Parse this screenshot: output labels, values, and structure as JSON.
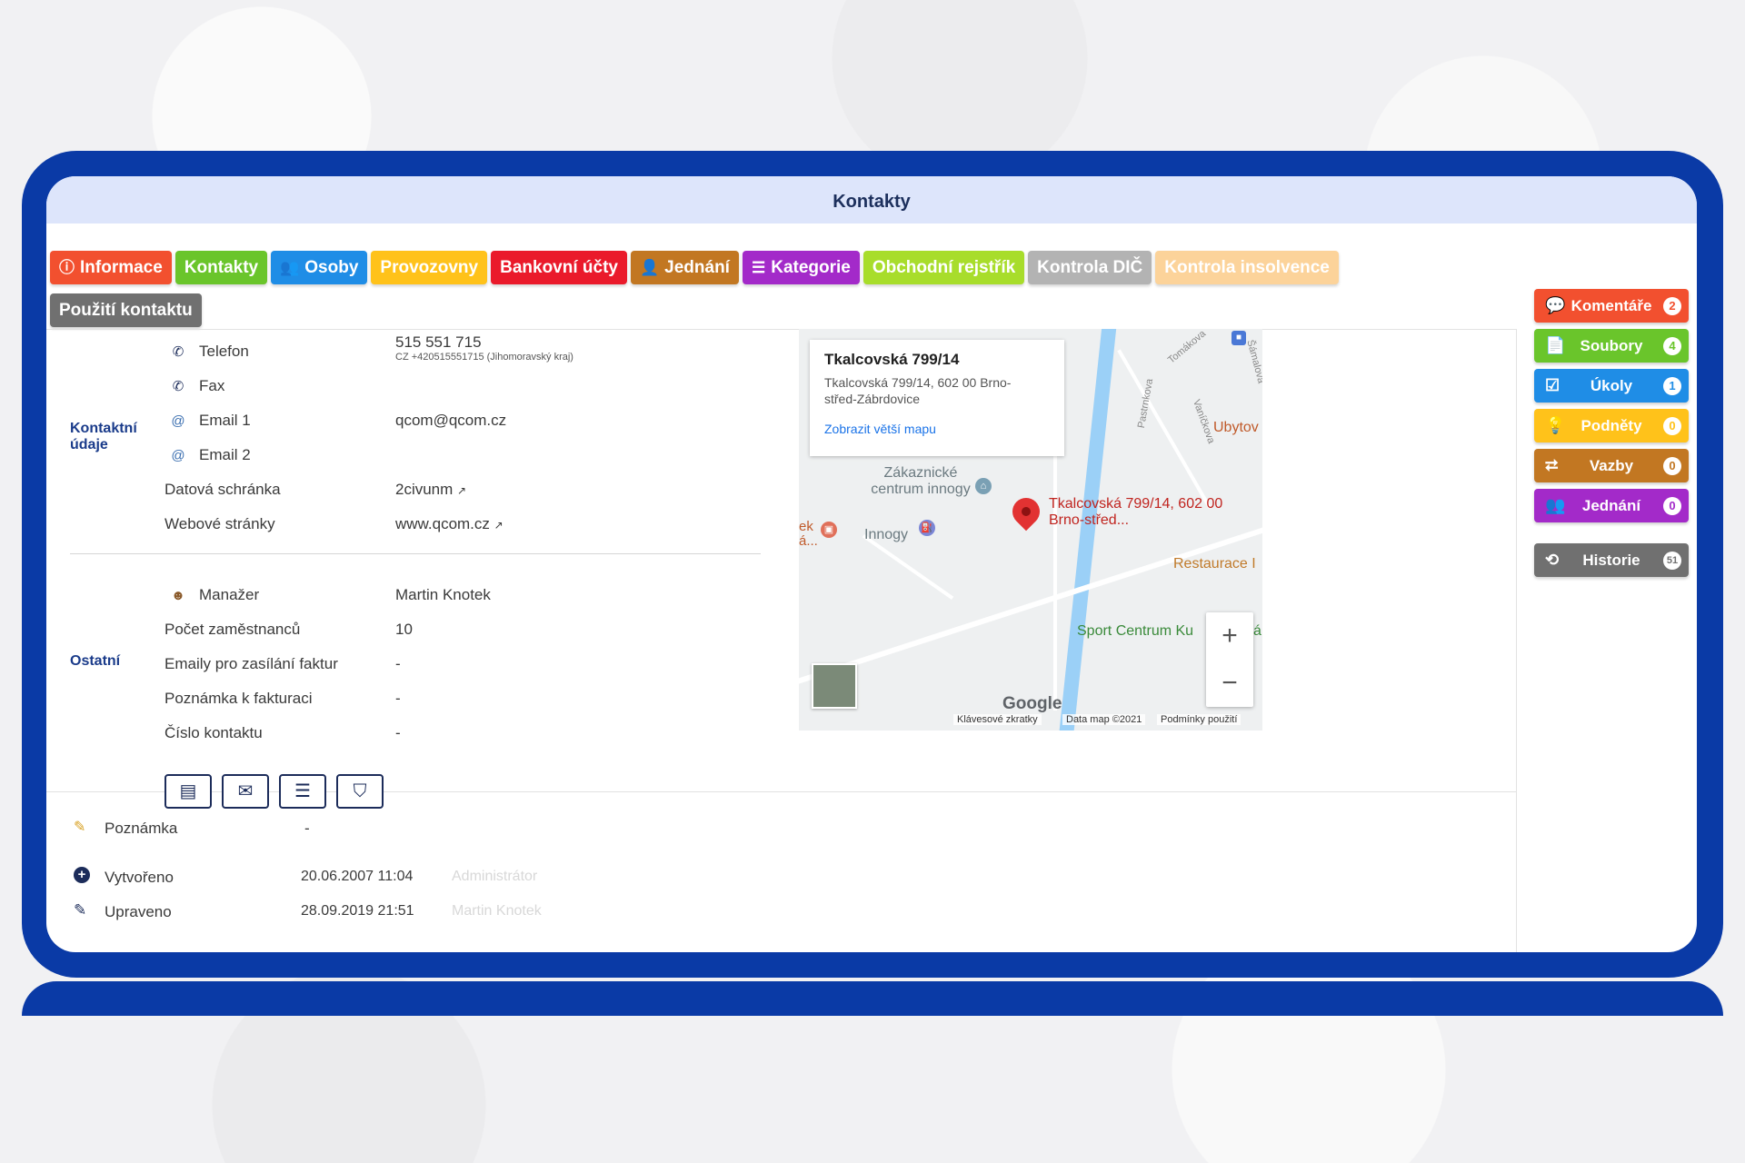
{
  "window_title": "Kontakty",
  "tabs": [
    {
      "label": "Informace",
      "icon": "ⓘ",
      "color": "#f2502f"
    },
    {
      "label": "Kontakty",
      "icon": "",
      "color": "#6ac52b"
    },
    {
      "label": "Osoby",
      "icon": "👥",
      "color": "#1f8de6"
    },
    {
      "label": "Provozovny",
      "icon": "",
      "color": "#ffc21a"
    },
    {
      "label": "Bankovní účty",
      "icon": "",
      "color": "#ea1a2b"
    },
    {
      "label": "Jednání",
      "icon": "👤",
      "color": "#c27722"
    },
    {
      "label": "Kategorie",
      "icon": "☰",
      "color": "#a32ac9"
    },
    {
      "label": "Obchodní rejstřík",
      "icon": "",
      "color": "#a8dd2b"
    },
    {
      "label": "Kontrola DIČ",
      "icon": "",
      "color": "#b3b3b3"
    },
    {
      "label": "Kontrola insolvence",
      "icon": "",
      "color": "#fcd39a"
    },
    {
      "label": "Použití kontaktu",
      "icon": "",
      "color": "#707070"
    }
  ],
  "contact": {
    "section_label": "Kontaktní údaje",
    "phone_label": "Telefon",
    "phone_value": "515 551 715",
    "phone_sub": "CZ +420515551715 (Jihomoravský kraj)",
    "fax_label": "Fax",
    "email1_label": "Email 1",
    "email1_value": "qcom@qcom.cz",
    "email2_label": "Email 2",
    "databox_label": "Datová schránka",
    "databox_value": "2civunm",
    "web_label": "Webové stránky",
    "web_value": "www.qcom.cz"
  },
  "other": {
    "section_label": "Ostatní",
    "manager_label": "Manažer",
    "manager_value": "Martin Knotek",
    "employees_label": "Počet zaměstnanců",
    "employees_value": "10",
    "invoice_emails_label": "Emaily pro zasílání faktur",
    "invoice_emails_value": "-",
    "invoice_note_label": "Poznámka k fakturaci",
    "invoice_note_value": "-",
    "contact_no_label": "Číslo kontaktu",
    "contact_no_value": "-"
  },
  "map": {
    "info_title": "Tkalcovská 799/14",
    "info_address": "Tkalcovská 799/14, 602 00 Brno-střed-Zábrdovice",
    "info_link": "Zobrazit větší mapu",
    "pin_label": "Tkalcovská 799/14, 602 00 Brno-střed...",
    "label_zakaznicke": "Zákaznické centrum innogy",
    "label_innogy": "Innogy",
    "label_ubytov": "Ubytov",
    "label_restaurace": "Restaurace I",
    "label_sport": "Sport Centrum Ku",
    "label_ek": "ek á...",
    "label_a": "á",
    "street_pastrnkova": "Pastrnkova",
    "street_vanickova": "Vaníčkova",
    "street_tomakova": "Tomákova",
    "street_samalova": "Šámalova",
    "zoom_in": "+",
    "zoom_out": "−",
    "google": "Google",
    "footer_shortcuts": "Klávesové zkratky",
    "footer_data": "Data map ©2021",
    "footer_terms": "Podmínky použití"
  },
  "side_buttons": [
    {
      "label": "Komentáře",
      "count": "2",
      "icon": "💬",
      "color": "#f2502f"
    },
    {
      "label": "Soubory",
      "count": "4",
      "icon": "📄",
      "color": "#6ac52b"
    },
    {
      "label": "Úkoly",
      "count": "1",
      "icon": "☑",
      "color": "#1f8de6"
    },
    {
      "label": "Podněty",
      "count": "0",
      "icon": "💡",
      "color": "#ffc21a"
    },
    {
      "label": "Vazby",
      "count": "0",
      "icon": "⮂",
      "color": "#c27722"
    },
    {
      "label": "Jednání",
      "count": "0",
      "icon": "👥",
      "color": "#a32ac9"
    },
    {
      "label": "Historie",
      "count": "51",
      "icon": "⟲",
      "color": "#707070"
    }
  ],
  "bottom": {
    "note_label": "Poznámka",
    "note_value": "-",
    "created_label": "Vytvořeno",
    "created_value": "20.06.2007 11:04",
    "created_by": "Administrátor",
    "updated_label": "Upraveno",
    "updated_value": "28.09.2019 21:51",
    "updated_by": "Martin Knotek"
  }
}
